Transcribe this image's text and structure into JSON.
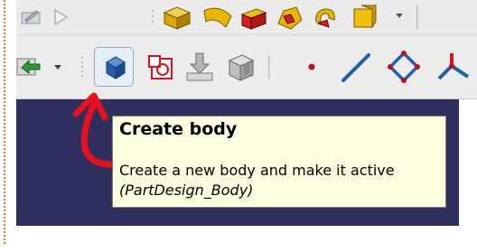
{
  "tooltip": {
    "title": "Create body",
    "description": "Create a new body and make it active",
    "command": "(PartDesign_Body)"
  },
  "icons": {
    "toolbar1": [
      "edit-icon",
      "play-icon",
      "box-icon",
      "sweep-icon",
      "pad-icon",
      "loft-icon",
      "revolve-icon",
      "cube-icon",
      "dropdown-arrow-icon"
    ],
    "toolbar2": [
      "switch-workbench-icon",
      "dropdown-arrow-icon",
      "create-body-icon",
      "create-sketch-icon",
      "import-icon",
      "clone-icon",
      "point-icon",
      "line-icon",
      "plane-icon",
      "coordinate-system-icon"
    ]
  },
  "colors": {
    "viewport": "#2f2f5f",
    "tooltip_bg": "#fefee0",
    "annotation_arrow": "#e8101c",
    "accent_blue": "#1f5fb0",
    "accent_red": "#d81020",
    "accent_yellow": "#e8c000"
  }
}
